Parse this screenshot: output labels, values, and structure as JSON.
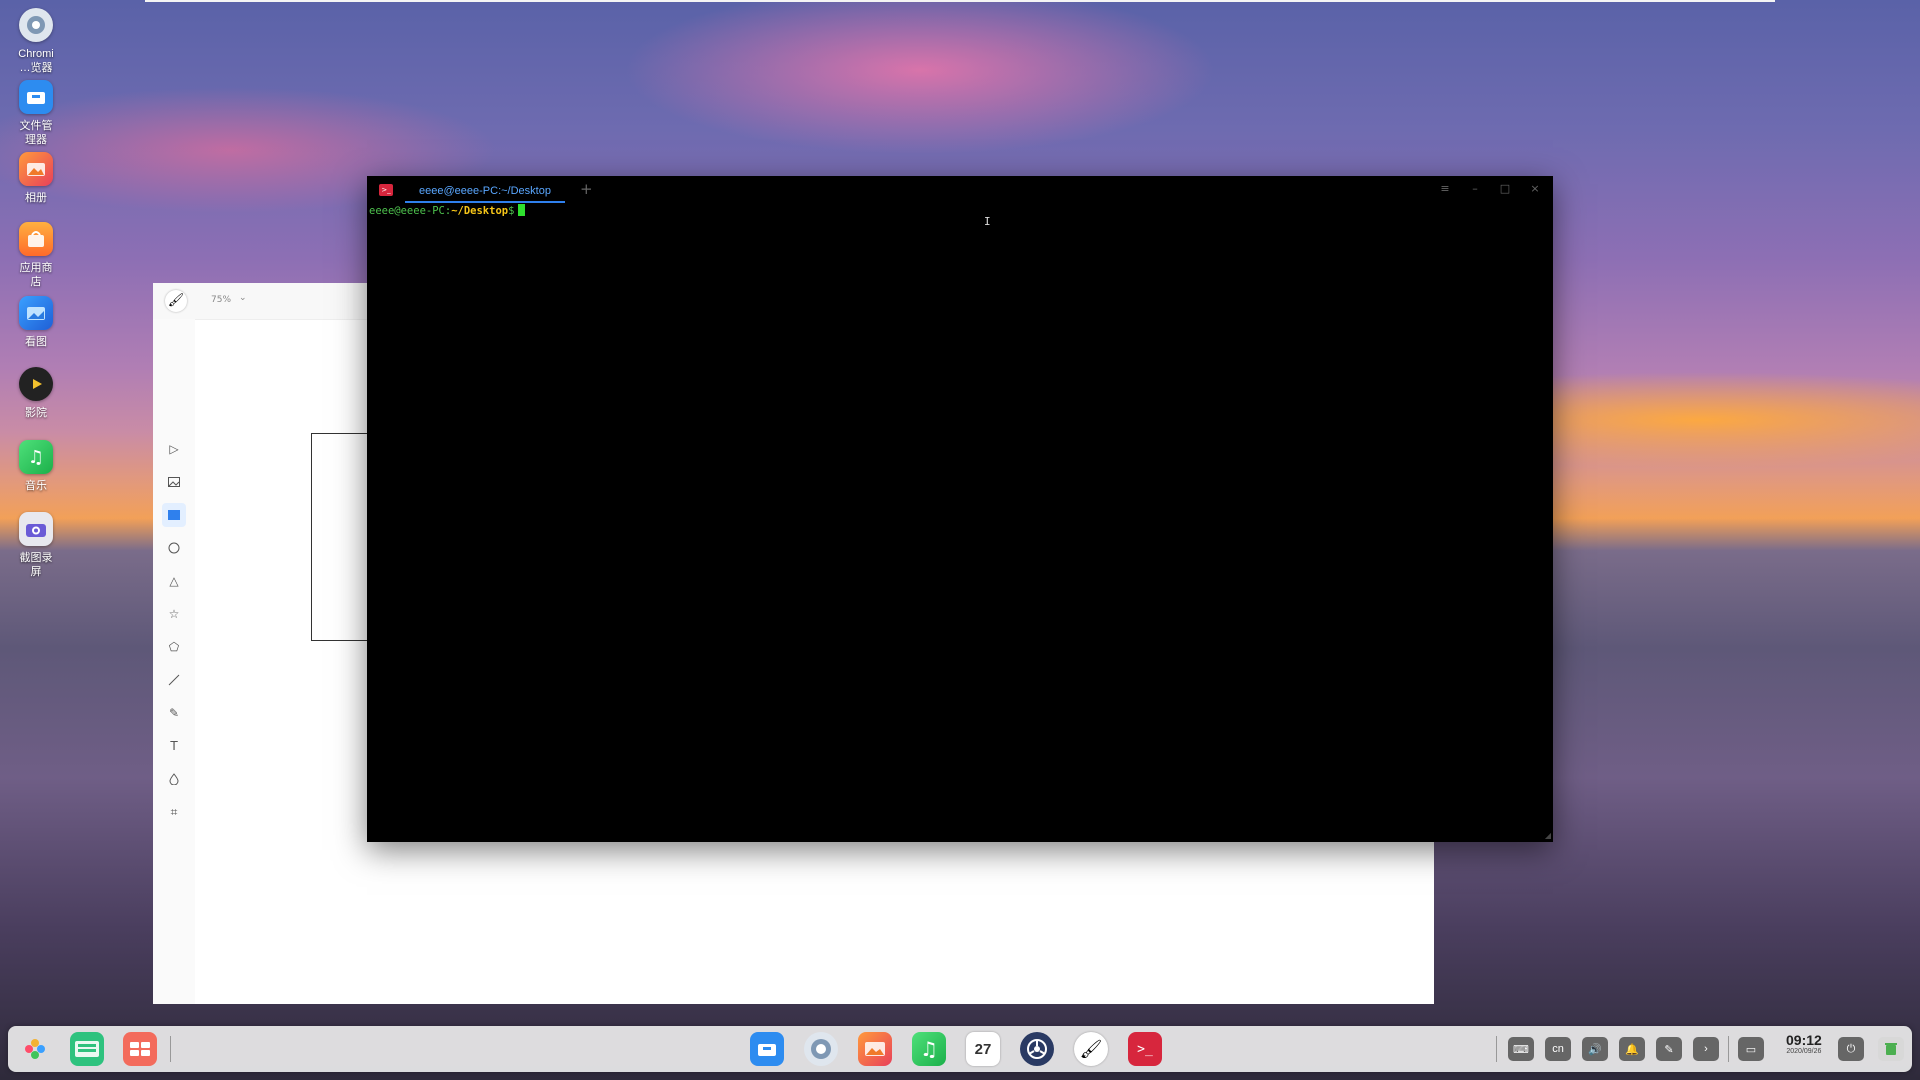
{
  "desktop": {
    "icons": [
      {
        "label": "Chromi\n…览器",
        "icon": "chromium-icon"
      },
      {
        "label": "文件管\n理器",
        "icon": "file-manager-icon"
      },
      {
        "label": "相册",
        "icon": "album-icon"
      },
      {
        "label": "应用商\n店",
        "icon": "app-store-icon"
      },
      {
        "label": "看图",
        "icon": "image-viewer-icon"
      },
      {
        "label": "影院",
        "icon": "movie-icon"
      },
      {
        "label": "音乐",
        "icon": "music-icon"
      },
      {
        "label": "截图录\n屏",
        "icon": "screenshot-icon"
      }
    ]
  },
  "draw": {
    "zoom": "75%",
    "tools": [
      "select-icon",
      "image-icon",
      "rectangle-icon",
      "ellipse-icon",
      "triangle-icon",
      "star-icon",
      "polygon-icon",
      "line-icon",
      "pencil-icon",
      "text-icon",
      "blur-icon",
      "crop-icon"
    ],
    "active_tool": "rectangle-icon"
  },
  "terminal": {
    "tab_title": "eeee@eeee-PC:~/Desktop",
    "prompt_user": "eeee@eeee-PC",
    "prompt_sep": ":",
    "prompt_path": "~/Desktop",
    "prompt_symbol": "$"
  },
  "taskbar": {
    "tray": {
      "keyboard": "⌨",
      "ime": "cn",
      "volume": "🔊",
      "notify": "🔔",
      "pen": "✎",
      "arrow": "›"
    },
    "time": "09:12",
    "date": "2020/09/26"
  },
  "colors": {
    "accent": "#2f80ed",
    "terminal_bg": "#000000",
    "prompt_user": "#4ec24e",
    "prompt_path": "#f5c518"
  }
}
